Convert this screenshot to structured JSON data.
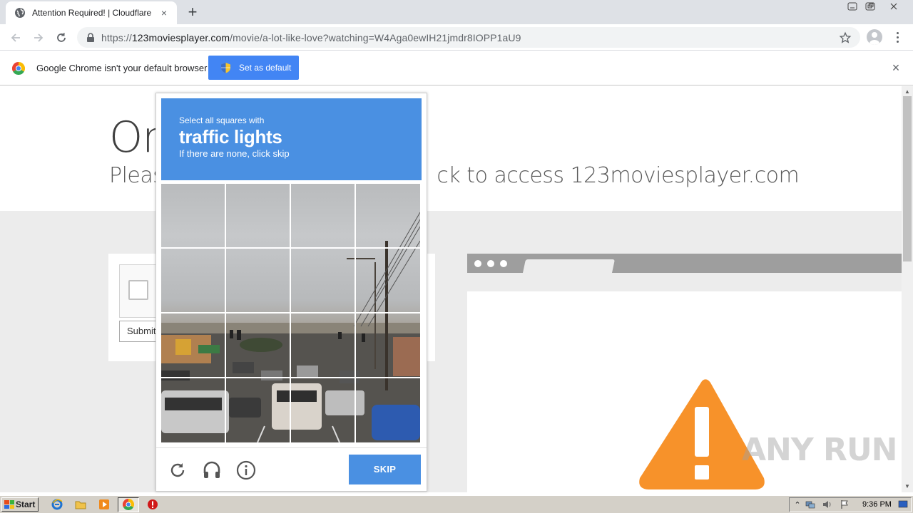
{
  "browser": {
    "tab": {
      "title": "Attention Required! | Cloudflare",
      "favicon": "globe-icon",
      "close": "×"
    },
    "new_tab": "+",
    "url": {
      "scheme": "https://",
      "host": "123moviesplayer.com",
      "path": "/movie/a-lot-like-love?watching=W4Aga0ewIH21jmdr8IOPP1aU9"
    }
  },
  "infobar": {
    "message": "Google Chrome isn't your default browser",
    "button": "Set as default",
    "close": "×"
  },
  "page": {
    "title": "On",
    "subtitle_left": "Pleas",
    "subtitle_right": "ck to access 123moviesplayer.com",
    "submit_label": "Submit"
  },
  "recaptcha": {
    "instruction": "Select all squares with",
    "target": "traffic lights",
    "hint": "If there are none, click skip",
    "skip_label": "SKIP",
    "icons": [
      "reload-icon",
      "audio-icon",
      "info-icon"
    ],
    "header_color": "#4a90e2"
  },
  "watermark": "ANY RUN",
  "taskbar": {
    "start_label": "Start",
    "clock": "9:36 PM",
    "icons": [
      "ie-icon",
      "folder-icon",
      "media-player-icon",
      "chrome-icon",
      "stop-icon"
    ]
  },
  "colors": {
    "accent": "#4285f4",
    "warning": "#f7922a"
  }
}
